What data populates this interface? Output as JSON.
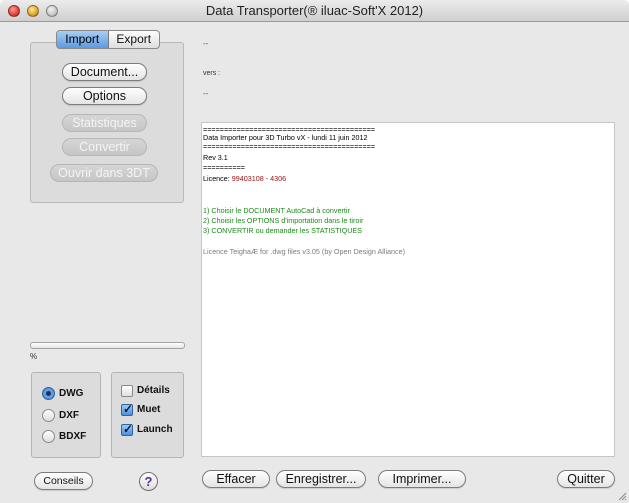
{
  "window": {
    "title": "Data Transporter(® iluac-Soft'X 2012)"
  },
  "tabs": [
    {
      "label": "Import",
      "selected": true
    },
    {
      "label": "Export",
      "selected": false
    }
  ],
  "actions": {
    "document": "Document...",
    "options": "Options",
    "statistiques": "Statistiques",
    "convertir": "Convertir",
    "ouvrir": "Ouvrir dans 3DT"
  },
  "progress": {
    "value": 0,
    "label": "%"
  },
  "format": {
    "options": [
      "DWG",
      "DXF",
      "BDXF"
    ],
    "selected": "DWG"
  },
  "flags": [
    {
      "label": "Détails",
      "checked": false
    },
    {
      "label": "Muet",
      "checked": true
    },
    {
      "label": "Launch",
      "checked": true
    }
  ],
  "footer": {
    "conseils": "Conseils",
    "help": "?",
    "effacer": "Effacer",
    "enregistrer": "Enregistrer...",
    "imprimer": "Imprimer...",
    "quitter": "Quitter"
  },
  "header_fields": {
    "source": "--",
    "vers_label": "vers :",
    "destination": "--"
  },
  "log": {
    "rule1": "=========================================",
    "line1": "Data Importer pour 3D Turbo vX - lundi 11 juin 2012",
    "rule2": "=========================================",
    "rev": "Rev 3.1",
    "rule3": "==========",
    "licence_label": "Licence: ",
    "licence_value": "99403108 - 4306",
    "step1": "1) Choisir le DOCUMENT AutoCad à convertir",
    "step2": "2) Choisir les OPTIONS d'importation dans le tiroir",
    "step3": "3) CONVERTIR ou demander les STATISTIQUES",
    "teigha": "Licence TeighaÆ for .dwg files v3.05 (by Open Design Alliance)"
  }
}
